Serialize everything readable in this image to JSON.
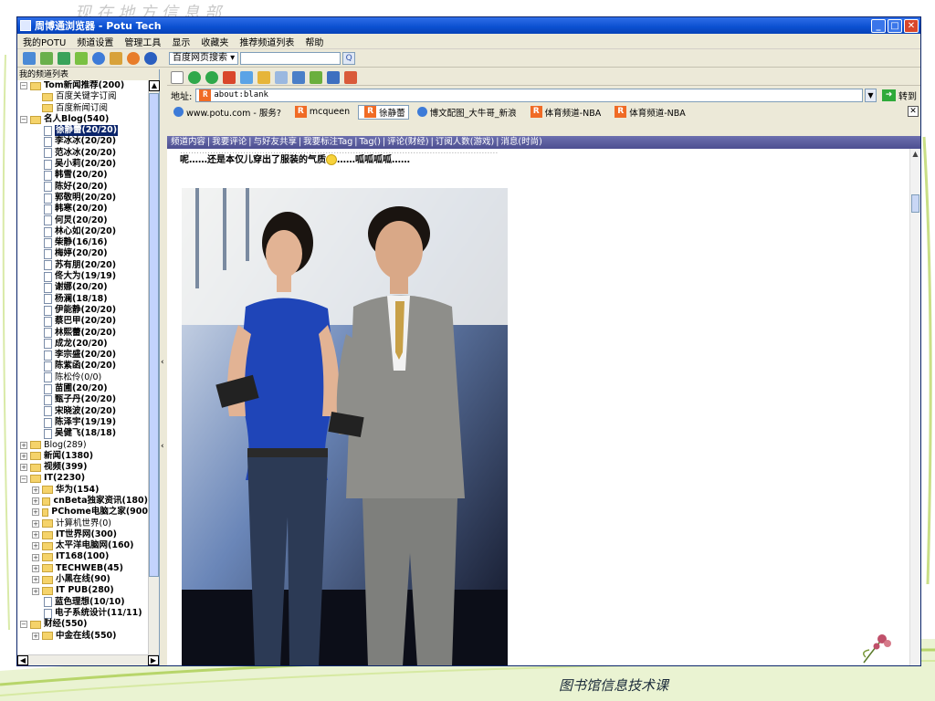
{
  "slide": {
    "heading": "…… 现 在 地 方 信 息 部",
    "footer": "图书馆信息技术课"
  },
  "window": {
    "title": "周博通浏览器 - Potu Tech",
    "buttons": {
      "minimize": "_",
      "maximize": "□",
      "close": "✕"
    }
  },
  "menu": [
    "我的POTU",
    "频道设置",
    "管理工具",
    "显示",
    "收藏夹",
    "推荐频道列表",
    "帮助"
  ],
  "search": {
    "engine": "百度网页搜索 ▾",
    "value": "",
    "go": "Q"
  },
  "sidebar": {
    "header": "我的频道列表",
    "tree": [
      {
        "label": "Tom新闻推荐(200)",
        "level": 0,
        "type": "folder",
        "exp": "−",
        "bold": true
      },
      {
        "label": "百度关键字订阅",
        "level": 1,
        "type": "folder"
      },
      {
        "label": "百度新闻订阅",
        "level": 1,
        "type": "folder"
      },
      {
        "label": "名人Blog(540)",
        "level": 0,
        "type": "folder",
        "exp": "−",
        "bold": true
      },
      {
        "label": "徐静蕾(20/20)",
        "level": 2,
        "type": "doc",
        "bold": true,
        "selected": true
      },
      {
        "label": "李冰冰(20/20)",
        "level": 2,
        "type": "doc",
        "bold": true
      },
      {
        "label": "范冰冰(20/20)",
        "level": 2,
        "type": "doc",
        "bold": true
      },
      {
        "label": "吴小莉(20/20)",
        "level": 2,
        "type": "doc",
        "bold": true
      },
      {
        "label": "韩雪(20/20)",
        "level": 2,
        "type": "doc",
        "bold": true
      },
      {
        "label": "陈好(20/20)",
        "level": 2,
        "type": "doc",
        "bold": true
      },
      {
        "label": "郭敬明(20/20)",
        "level": 2,
        "type": "doc",
        "bold": true
      },
      {
        "label": "韩寒(20/20)",
        "level": 2,
        "type": "doc",
        "bold": true
      },
      {
        "label": "何炅(20/20)",
        "level": 2,
        "type": "doc",
        "bold": true
      },
      {
        "label": "林心如(20/20)",
        "level": 2,
        "type": "doc",
        "bold": true
      },
      {
        "label": "柴静(16/16)",
        "level": 2,
        "type": "doc",
        "bold": true
      },
      {
        "label": "梅婷(20/20)",
        "level": 2,
        "type": "doc",
        "bold": true
      },
      {
        "label": "苏有朋(20/20)",
        "level": 2,
        "type": "doc",
        "bold": true
      },
      {
        "label": "佟大为(19/19)",
        "level": 2,
        "type": "doc",
        "bold": true
      },
      {
        "label": "谢娜(20/20)",
        "level": 2,
        "type": "doc",
        "bold": true
      },
      {
        "label": "杨澜(18/18)",
        "level": 2,
        "type": "doc",
        "bold": true
      },
      {
        "label": "伊能静(20/20)",
        "level": 2,
        "type": "doc",
        "bold": true
      },
      {
        "label": "蔡巴甲(20/20)",
        "level": 2,
        "type": "doc",
        "bold": true
      },
      {
        "label": "林熙蕾(20/20)",
        "level": 2,
        "type": "doc",
        "bold": true
      },
      {
        "label": "成龙(20/20)",
        "level": 2,
        "type": "doc",
        "bold": true
      },
      {
        "label": "李宗盛(20/20)",
        "level": 2,
        "type": "doc",
        "bold": true
      },
      {
        "label": "陈紫函(20/20)",
        "level": 2,
        "type": "doc",
        "bold": true
      },
      {
        "label": "陈松伶(0/0)",
        "level": 2,
        "type": "doc",
        "bold": false
      },
      {
        "label": "苗圃(20/20)",
        "level": 2,
        "type": "doc",
        "bold": true
      },
      {
        "label": "甄子丹(20/20)",
        "level": 2,
        "type": "doc",
        "bold": true
      },
      {
        "label": "宋晓波(20/20)",
        "level": 2,
        "type": "doc",
        "bold": true
      },
      {
        "label": "陈泽宇(19/19)",
        "level": 2,
        "type": "doc",
        "bold": true
      },
      {
        "label": "吴健飞(18/18)",
        "level": 2,
        "type": "doc",
        "bold": true
      },
      {
        "label": "Blog(289)",
        "level": 0,
        "type": "folder",
        "exp": "+",
        "bold": false
      },
      {
        "label": "新闻(1380)",
        "level": 0,
        "type": "folder",
        "exp": "+",
        "bold": true
      },
      {
        "label": "视频(399)",
        "level": 0,
        "type": "folder",
        "exp": "+",
        "bold": true
      },
      {
        "label": "IT(2230)",
        "level": 0,
        "type": "folder",
        "exp": "−",
        "bold": true
      },
      {
        "label": "华为(154)",
        "level": 1,
        "type": "folder",
        "exp": "+",
        "bold": true
      },
      {
        "label": "cnBeta独家资讯(180)",
        "level": 1,
        "type": "folder",
        "exp": "+",
        "bold": true
      },
      {
        "label": "PChome电脑之家(900",
        "level": 1,
        "type": "folder",
        "exp": "+",
        "bold": true
      },
      {
        "label": "计算机世界(0)",
        "level": 1,
        "type": "folder",
        "exp": "+",
        "bold": false
      },
      {
        "label": "IT世界网(300)",
        "level": 1,
        "type": "folder",
        "exp": "+",
        "bold": true
      },
      {
        "label": "太平洋电脑网(160)",
        "level": 1,
        "type": "folder",
        "exp": "+",
        "bold": true
      },
      {
        "label": "IT168(100)",
        "level": 1,
        "type": "folder",
        "exp": "+",
        "bold": true
      },
      {
        "label": "TECHWEB(45)",
        "level": 1,
        "type": "folder",
        "exp": "+",
        "bold": true
      },
      {
        "label": "小黑在线(90)",
        "level": 1,
        "type": "folder",
        "exp": "+",
        "bold": true
      },
      {
        "label": "IT PUB(280)",
        "level": 1,
        "type": "folder",
        "exp": "+",
        "bold": true
      },
      {
        "label": "蓝色理想(10/10)",
        "level": 2,
        "type": "doc",
        "bold": true
      },
      {
        "label": "电子系统设计(11/11)",
        "level": 2,
        "type": "doc",
        "bold": true
      },
      {
        "label": "财经(550)",
        "level": 0,
        "type": "folder",
        "exp": "−",
        "bold": true
      },
      {
        "label": "中金在线(550)",
        "level": 1,
        "type": "folder",
        "exp": "+",
        "bold": true
      }
    ]
  },
  "address": {
    "label": "地址:",
    "value": "about:blank",
    "go": "转到"
  },
  "tabs": [
    {
      "label": "www.potu.com - 服务?",
      "icon": "ie",
      "active": false
    },
    {
      "label": "mcqueen",
      "icon": "rss",
      "active": false
    },
    {
      "label": "徐静蕾",
      "icon": "rss",
      "active": true
    },
    {
      "label": "博文配图_大牛哥_新浪",
      "icon": "ie",
      "active": false
    },
    {
      "label": "体育频道-NBA",
      "icon": "rss",
      "active": false
    },
    {
      "label": "体育频道-NBA",
      "icon": "rss",
      "active": false
    }
  ],
  "nav_links": [
    "频道内容",
    "我要评论",
    "与好友共享",
    "我要标注Tag",
    "Tag()",
    "评论(财经)",
    "订阅人数(游戏)",
    "消息(时尚)"
  ],
  "post": {
    "line2": "呢……还是本仅儿穿出了服装的气质",
    "line2_end": "……呱呱呱呱……"
  },
  "colors": {
    "accent": "#0a4fd0",
    "nav_strip": "#5c5ea0",
    "selection": "#0a246a"
  }
}
